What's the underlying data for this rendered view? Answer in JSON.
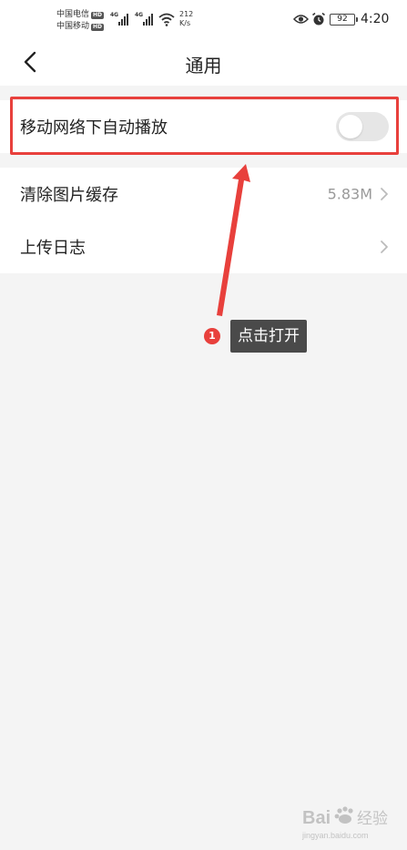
{
  "status_bar": {
    "carrier1": "中国电信",
    "carrier2": "中国移动",
    "hd": "HD",
    "signal_label1": "4G",
    "signal_label2": "4G",
    "net_speed_value": "212",
    "net_speed_unit": "K/s",
    "battery": "92",
    "time": "4:20"
  },
  "header": {
    "title": "通用",
    "back_icon": "chevron-left-icon"
  },
  "settings": {
    "autoplay": {
      "label": "移动网络下自动播放",
      "enabled": false
    },
    "clear_cache": {
      "label": "清除图片缓存",
      "value": "5.83M"
    },
    "upload_log": {
      "label": "上传日志"
    }
  },
  "annotation": {
    "step": "1",
    "tip": "点击打开",
    "color": "#e8403c"
  },
  "watermark": {
    "text": "Bai 经验",
    "domain": "jingyan.baidu.com"
  }
}
